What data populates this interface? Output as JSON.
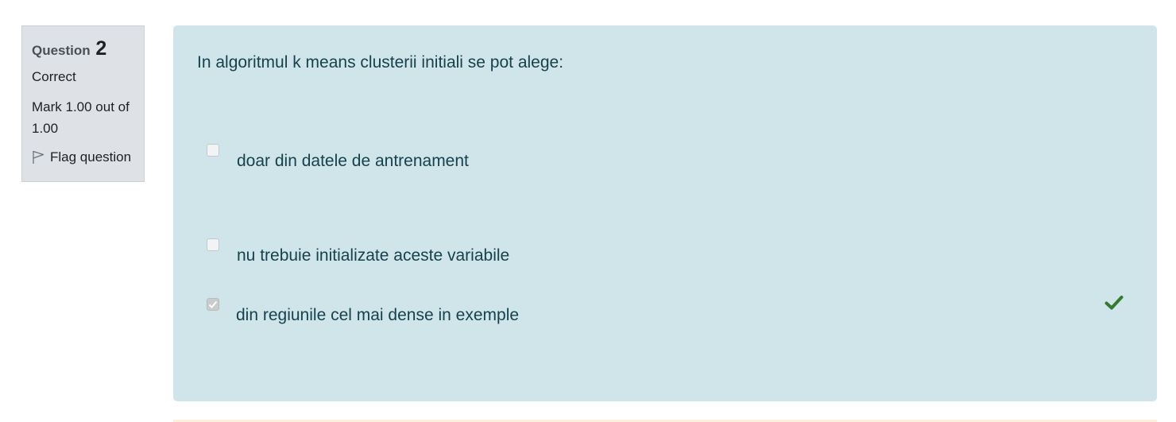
{
  "question_info": {
    "question_label": "Question",
    "question_number": "2",
    "state": "Correct",
    "grade": "Mark 1.00 out of 1.00",
    "flag_label": "Flag question"
  },
  "question": {
    "text": "In algoritmul k means clusterii initiali se pot alege:",
    "options": [
      {
        "label": "doar din datele de antrenament",
        "checked": false
      },
      {
        "label": "nu trebuie initializate aceste variabile",
        "checked": false
      },
      {
        "label": "din regiunile cel mai dense in exemple",
        "checked": true,
        "feedback_icon": "check-icon"
      }
    ]
  },
  "colors": {
    "info_bg": "#dee2e6",
    "content_bg": "#cfe5ea",
    "text": "#17414d",
    "correct_tick": "#357a32"
  }
}
